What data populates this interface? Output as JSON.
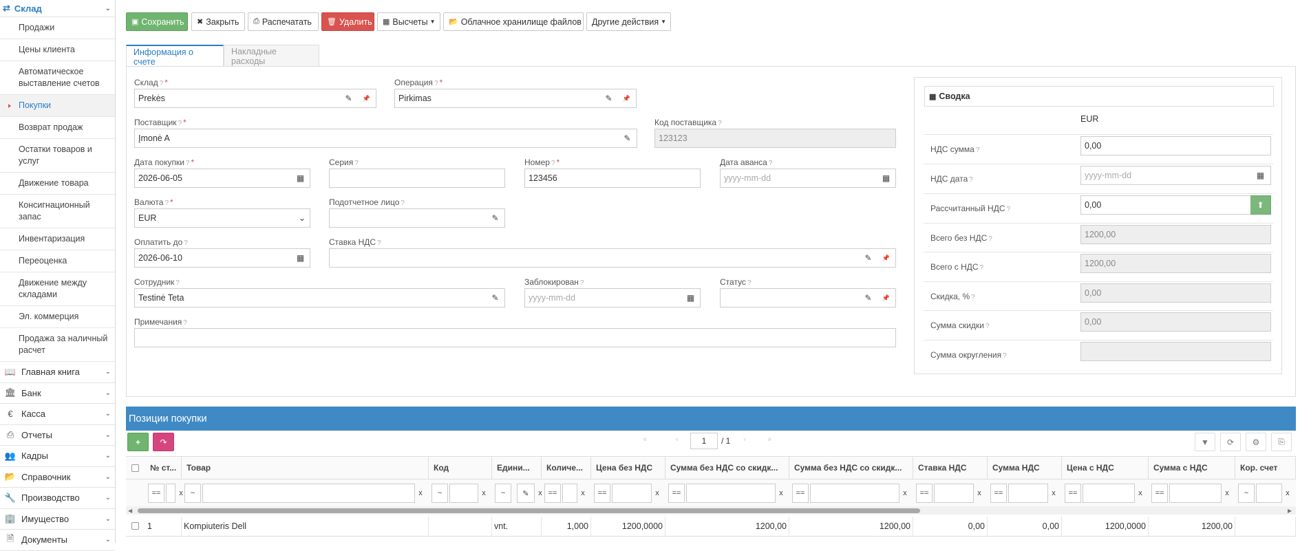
{
  "sidebar": {
    "section_title": "Склад",
    "sub_items": [
      {
        "label": "Продажи"
      },
      {
        "label": "Цены клиента"
      },
      {
        "label": "Автоматическое выставление счетов"
      },
      {
        "label": "Покупки",
        "active": true
      },
      {
        "label": "Возврат продаж"
      },
      {
        "label": "Остатки товаров и услуг"
      },
      {
        "label": "Движение товара"
      },
      {
        "label": "Консигнационный запас"
      },
      {
        "label": "Инвентаризация"
      },
      {
        "label": "Переоценка"
      },
      {
        "label": "Движение между складами"
      },
      {
        "label": "Эл. коммерция"
      },
      {
        "label": "Продажа за наличный расчет"
      }
    ],
    "main_items": [
      {
        "label": "Главная книга",
        "icon": "book-icon"
      },
      {
        "label": "Банк",
        "icon": "bank-icon"
      },
      {
        "label": "Касса",
        "icon": "euro-icon"
      },
      {
        "label": "Отчеты",
        "icon": "printer-icon"
      },
      {
        "label": "Кадры",
        "icon": "users-icon"
      },
      {
        "label": "Справочник",
        "icon": "folder-icon"
      },
      {
        "label": "Производство",
        "icon": "wrench-icon"
      },
      {
        "label": "Имущество",
        "icon": "building-icon"
      },
      {
        "label": "Документы",
        "icon": "document-icon"
      }
    ]
  },
  "toolbar": {
    "save": "Сохранить",
    "close": "Закрыть",
    "print": "Распечатать",
    "delete": "Удалить",
    "calculations": "Высчеты",
    "cloud": "Облачное хранилище файлов",
    "other": "Другие действия"
  },
  "tabs": {
    "invoice_info": "Информация о счете",
    "overhead": "Накладные расходы"
  },
  "form": {
    "warehouse": {
      "label": "Склад",
      "value": "Prekės"
    },
    "operation": {
      "label": "Операция",
      "value": "Pirkimas"
    },
    "supplier": {
      "label": "Поставщик",
      "value": "Įmonė A"
    },
    "supplier_code": {
      "label": "Код поставщика",
      "value": "123123"
    },
    "purchase_date": {
      "label": "Дата покупки",
      "value": "2026-06-05"
    },
    "series": {
      "label": "Серия",
      "value": ""
    },
    "number": {
      "label": "Номер",
      "value": "123456"
    },
    "advance_date": {
      "label": "Дата аванса",
      "placeholder": "yyyy-mm-dd"
    },
    "currency": {
      "label": "Валюта",
      "value": "EUR"
    },
    "accountable_person": {
      "label": "Подотчетное лицо",
      "value": ""
    },
    "pay_until": {
      "label": "Оплатить до",
      "value": "2026-06-10"
    },
    "vat_rate": {
      "label": "Ставка НДС",
      "value": ""
    },
    "employee": {
      "label": "Сотрудник",
      "value": "Testinė Teta"
    },
    "blocked": {
      "label": "Заблокирован",
      "placeholder": "yyyy-mm-dd"
    },
    "status": {
      "label": "Статус",
      "value": ""
    },
    "notes": {
      "label": "Примечания",
      "value": ""
    }
  },
  "summary": {
    "title": "Сводка",
    "currency": "EUR",
    "rows": [
      {
        "label": "НДС сумма",
        "value": "0,00"
      },
      {
        "label": "НДС дата",
        "placeholder": "yyyy-mm-dd"
      },
      {
        "label": "Рассчитанный НДС",
        "value": "0,00"
      },
      {
        "label": "Всего без НДС",
        "value": "1200,00"
      },
      {
        "label": "Всего с НДС",
        "value": "1200,00"
      },
      {
        "label": "Скидка, %",
        "value": "0,00"
      },
      {
        "label": "Сумма скидки",
        "value": "0,00"
      },
      {
        "label": "Сумма округления",
        "value": ""
      }
    ]
  },
  "positions": {
    "title": "Позиции покупки",
    "page": "1",
    "page_total": "/ 1",
    "columns": [
      "№ ст...",
      "Товар",
      "Код",
      "Едини...",
      "Количе...",
      "Цена без НДС",
      "Сумма без НДС со скидк...",
      "Сумма без НДС со скидк...",
      "Ставка НДС",
      "Сумма НДС",
      "Цена с НДС",
      "Сумма с НДС",
      "Кор. счет"
    ],
    "filter_ops": [
      "==",
      "~",
      "~",
      "~",
      "==",
      "==",
      "==",
      "==",
      "==",
      "==",
      "==",
      "==",
      "~"
    ],
    "rows": [
      {
        "no": "1",
        "product": "Kompiuteris Dell",
        "code": "",
        "unit": "vnt.",
        "qty": "1,000",
        "price": "1200,0000",
        "sum1": "1200,00",
        "sum2": "1200,00",
        "vat_rate": "0,00",
        "vat_sum": "0,00",
        "price_vat": "1200,0000",
        "sum_vat": "1200,00",
        "account": ""
      }
    ]
  },
  "colors": {
    "accent": "#2a7ec4",
    "save": "#6fb46f",
    "delete": "#d9534f",
    "bar": "#3f89c4",
    "share": "#d6457e"
  }
}
